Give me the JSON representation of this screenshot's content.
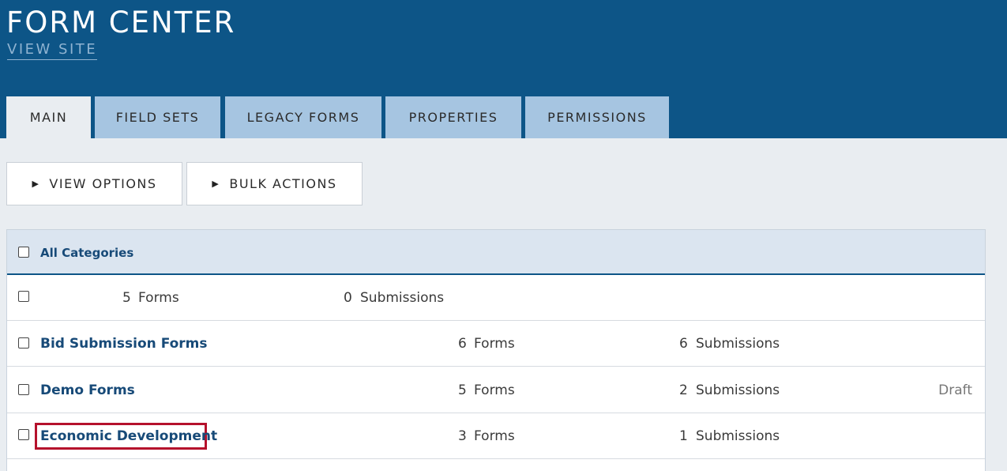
{
  "header": {
    "title": "FORM CENTER",
    "view_site": "VIEW SITE"
  },
  "tabs": [
    {
      "label": "MAIN",
      "active": true
    },
    {
      "label": "FIELD SETS",
      "active": false
    },
    {
      "label": "LEGACY FORMS",
      "active": false
    },
    {
      "label": "PROPERTIES",
      "active": false
    },
    {
      "label": "PERMISSIONS",
      "active": false
    }
  ],
  "toolbar": {
    "view_options": "VIEW OPTIONS",
    "bulk_actions": "BULK ACTIONS"
  },
  "table": {
    "header_label": "All Categories",
    "rows": [
      {
        "name": "",
        "forms_count": "5",
        "forms_label": "Forms",
        "submissions_count": "0",
        "submissions_label": "Submissions",
        "status": ""
      },
      {
        "name": "Bid Submission Forms",
        "forms_count": "6",
        "forms_label": "Forms",
        "submissions_count": "6",
        "submissions_label": "Submissions",
        "status": ""
      },
      {
        "name": "Demo Forms",
        "forms_count": "5",
        "forms_label": "Forms",
        "submissions_count": "2",
        "submissions_label": "Submissions",
        "status": "Draft"
      },
      {
        "name": "Economic Development",
        "forms_count": "3",
        "forms_label": "Forms",
        "submissions_count": "1",
        "submissions_label": "Submissions",
        "status": "",
        "highlighted": true
      }
    ]
  },
  "colors": {
    "header_bg": "#0d5587",
    "tab_bg": "#a6c5e1",
    "link": "#174a78",
    "highlight": "#b5112c"
  }
}
